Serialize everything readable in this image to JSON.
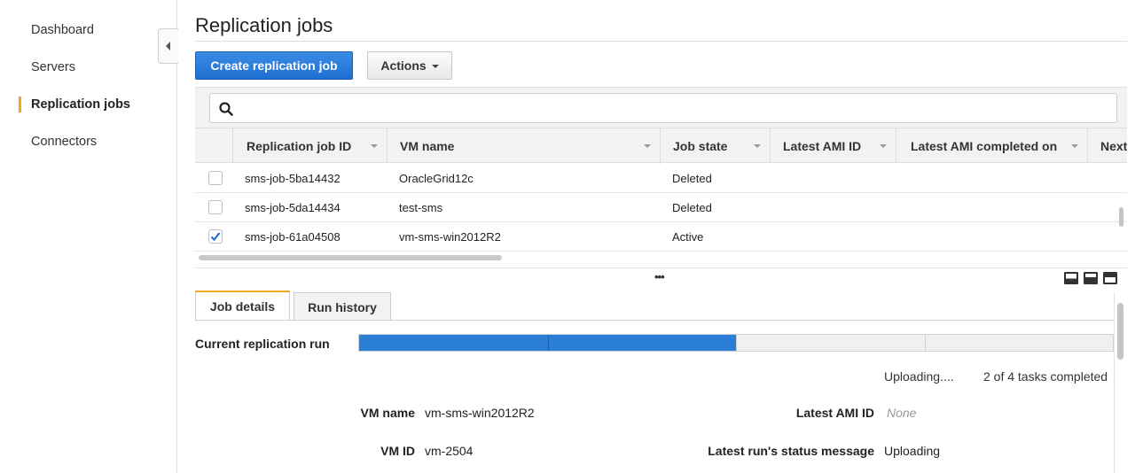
{
  "sidebar": {
    "items": [
      {
        "label": "Dashboard"
      },
      {
        "label": "Servers"
      },
      {
        "label": "Replication jobs",
        "active": true
      },
      {
        "label": "Connectors"
      }
    ]
  },
  "header": {
    "title": "Replication jobs",
    "create_button": "Create replication job",
    "actions_button": "Actions"
  },
  "search": {
    "placeholder": ""
  },
  "table": {
    "columns": [
      "Replication job ID",
      "VM name",
      "Job state",
      "Latest AMI ID",
      "Latest AMI completed on",
      "Next"
    ],
    "rows": [
      {
        "checked": false,
        "id": "sms-job-5ba14432",
        "vm_name": "OracleGrid12c",
        "state": "Deleted"
      },
      {
        "checked": false,
        "id": "sms-job-5da14434",
        "vm_name": "test-sms",
        "state": "Deleted"
      },
      {
        "checked": true,
        "id": "sms-job-61a04508",
        "vm_name": "vm-sms-win2012R2",
        "state": "Active"
      }
    ]
  },
  "splitter": {
    "ellipsis": "•••"
  },
  "details": {
    "tabs": [
      "Job details",
      "Run history"
    ],
    "run_label": "Current replication run",
    "progress": {
      "completed": 2,
      "total": 4
    },
    "status": "Uploading....",
    "tasks": "2 of 4 tasks completed",
    "fields": {
      "vm_name_label": "VM name",
      "vm_name_value": "vm-sms-win2012R2",
      "vm_id_label": "VM ID",
      "vm_id_value": "vm-2504",
      "ami_label": "Latest AMI ID",
      "ami_value": "None",
      "status_msg_label": "Latest run's status message",
      "status_msg_value": "Uploading"
    }
  },
  "colors": {
    "accent": "#f0a81c",
    "primary": "#1e6fd0",
    "progress": "#2a7ed6"
  }
}
